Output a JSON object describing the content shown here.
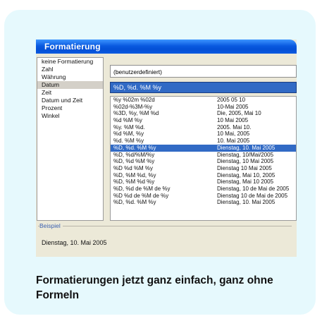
{
  "window": {
    "title": "Formatierung"
  },
  "categories": [
    {
      "label": "keine Formatierung",
      "selected": false
    },
    {
      "label": "Zahl",
      "selected": false
    },
    {
      "label": "Währung",
      "selected": false
    },
    {
      "label": "Datum",
      "selected": true
    },
    {
      "label": "Zeit",
      "selected": false
    },
    {
      "label": "Datum und Zeit",
      "selected": false
    },
    {
      "label": "Prozent",
      "selected": false
    },
    {
      "label": "Winkel",
      "selected": false
    }
  ],
  "format_selector": {
    "value": "(benutzerdefiniert)"
  },
  "format_code": {
    "value": "%D, %d. %M %y"
  },
  "format_list": [
    {
      "code": "%y %02m %02d",
      "example": "2005 05 10",
      "selected": false
    },
    {
      "code": "%02d-%3M-%y",
      "example": "10-Mai 2005",
      "selected": false
    },
    {
      "code": "%3D, %y, %M %d",
      "example": "Die, 2005, Mai 10",
      "selected": false
    },
    {
      "code": "%d %M %y",
      "example": "10 Mai 2005",
      "selected": false
    },
    {
      "code": "%y. %M %d.",
      "example": "2005. Mai 10.",
      "selected": false
    },
    {
      "code": "%d %M, %y",
      "example": "10 Mai, 2005",
      "selected": false
    },
    {
      "code": "%d. %M %y",
      "example": "10. Mai 2005",
      "selected": false
    },
    {
      "code": "%D, %d. %M %y",
      "example": "Dienstag, 10. Mai 2005",
      "selected": true
    },
    {
      "code": "%D, %d/%M/%y",
      "example": "Dienstag, 10/Mai/2005",
      "selected": false
    },
    {
      "code": "%D, %d %M %y",
      "example": "Dienstag, 10 Mai 2005",
      "selected": false
    },
    {
      "code": "%D %d %M %y",
      "example": "Dienstag 10 Mai 2005",
      "selected": false
    },
    {
      "code": "%D, %M %d, %y",
      "example": "Dienstag, Mai 10, 2005",
      "selected": false
    },
    {
      "code": "%D, %M %d %y",
      "example": "Dienstag, Mai 10 2005",
      "selected": false
    },
    {
      "code": "%D, %d de %M de %y",
      "example": "Dienstag, 10 de Mai de 2005",
      "selected": false
    },
    {
      "code": "%D %d de %M de %y",
      "example": "Dienstag 10 de Mai de 2005",
      "selected": false
    },
    {
      "code": "%D, %d. %M %y",
      "example": "Dienstag, 10. Mai 2005",
      "selected": false
    }
  ],
  "example_box": {
    "legend": "Beispiel",
    "value": "Dienstag, 10. Mai 2005"
  },
  "caption": "Formatierungen jetzt ganz einfach, ganz ohne Formeln",
  "colors": {
    "card_bg": "#e6f9fd",
    "selection": "#316ac5",
    "titlebar": "#0a5ae0"
  }
}
